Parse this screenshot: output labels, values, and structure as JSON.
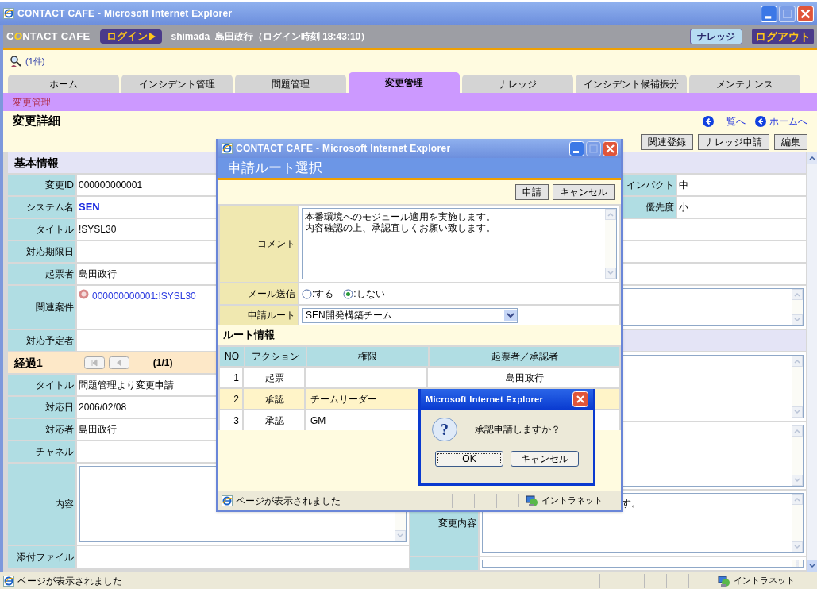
{
  "window": {
    "title": "CONTACT CAFE - Microsoft Internet Explorer"
  },
  "header": {
    "logo": "CONTACT CAFE",
    "login": "ログイン",
    "user": "shimada  島田政行（ログイン時刻 18:43:10）",
    "buttons": [
      {
        "label": "ナレッジ",
        "kind": "light"
      },
      {
        "label": "ログアウト",
        "kind": "dark"
      }
    ]
  },
  "search_count": "(1件)",
  "tabs": [
    {
      "label": "ホーム",
      "selected": false
    },
    {
      "label": "インシデント管理",
      "selected": false
    },
    {
      "label": "問題管理",
      "selected": false
    },
    {
      "label": "変更管理",
      "selected": true
    },
    {
      "label": "ナレッジ",
      "selected": false
    },
    {
      "label": "インシデント候補振分",
      "selected": false
    },
    {
      "label": "メンテナンス",
      "selected": false
    }
  ],
  "breadcrumb": "変更管理",
  "page_title": "変更詳細",
  "nav_links": [
    "一覧へ",
    "ホームへ"
  ],
  "actions": [
    "関連登録",
    "ナレッジ申請",
    "編集"
  ],
  "basic_info": {
    "title": "基本情報",
    "fields": [
      {
        "label": "変更ID",
        "value": "000000000001",
        "kind": "text"
      },
      {
        "label": "システム名",
        "value": "SEN",
        "kind": "strong"
      },
      {
        "label": "タイトル",
        "value": "!SYSL30",
        "kind": "text"
      },
      {
        "label": "対応期限日",
        "kind": "text"
      },
      {
        "label": "起票者",
        "value": "島田政行",
        "kind": "text"
      },
      {
        "label": "関連案件",
        "value": "000000000001:!SYSL30",
        "kind": "related"
      },
      {
        "label": "対応予定者",
        "kind": "text"
      }
    ]
  },
  "right_fields": [
    {
      "label": "インパクト",
      "value": "中"
    },
    {
      "label": "優先度",
      "value": "小"
    }
  ],
  "progress": {
    "title": "経過1",
    "pager": "(1/1)",
    "fields": [
      {
        "label": "タイトル",
        "value": "問題管理より変更申請",
        "kind": "text"
      },
      {
        "label": "対応日",
        "value": "2006/02/08",
        "kind": "text"
      },
      {
        "label": "対応者",
        "value": "島田政行",
        "kind": "text"
      },
      {
        "label": "チャネル",
        "kind": "text"
      },
      {
        "label": "内容",
        "kind": "textarea"
      },
      {
        "label": "添付ファイル",
        "kind": "text"
      }
    ]
  },
  "change_content": {
    "label": "変更内容",
    "visible_text": "す。"
  },
  "status_bar": {
    "text": "ページが表示されました",
    "zone": "イントラネット"
  },
  "popup": {
    "title": "CONTACT CAFE - Microsoft Internet Explorer",
    "heading": "申請ルート選択",
    "buttons": [
      "申請",
      "キャンセル"
    ],
    "comment_label": "コメント",
    "comment": [
      "本番環境へのモジュール適用を実施します。",
      "内容確認の上、承認宜しくお願い致します。"
    ],
    "mail_label": "メール送信",
    "mail_options": [
      {
        "label": ":する",
        "selected": false
      },
      {
        "label": ":しない",
        "selected": true
      }
    ],
    "route_label": "申請ルート",
    "route": "SEN開発構築チーム",
    "route_info": "ルート情報",
    "columns": [
      "NO",
      "アクション",
      "権限",
      "起票者／承認者"
    ],
    "rows": [
      {
        "no": "1",
        "action": "起票",
        "role": "",
        "person": "島田政行",
        "selected": false
      },
      {
        "no": "2",
        "action": "承認",
        "role": "チームリーダー",
        "person": "",
        "selected": true
      },
      {
        "no": "3",
        "action": "承認",
        "role": "GM",
        "person": "",
        "selected": false
      }
    ],
    "status_text": "ページが表示されました",
    "zone": "イントラネット"
  },
  "dialog": {
    "title": "Microsoft Internet Explorer",
    "icon": "?",
    "message": "承認申請しますか？",
    "buttons": [
      "OK",
      "キャンセル"
    ]
  }
}
